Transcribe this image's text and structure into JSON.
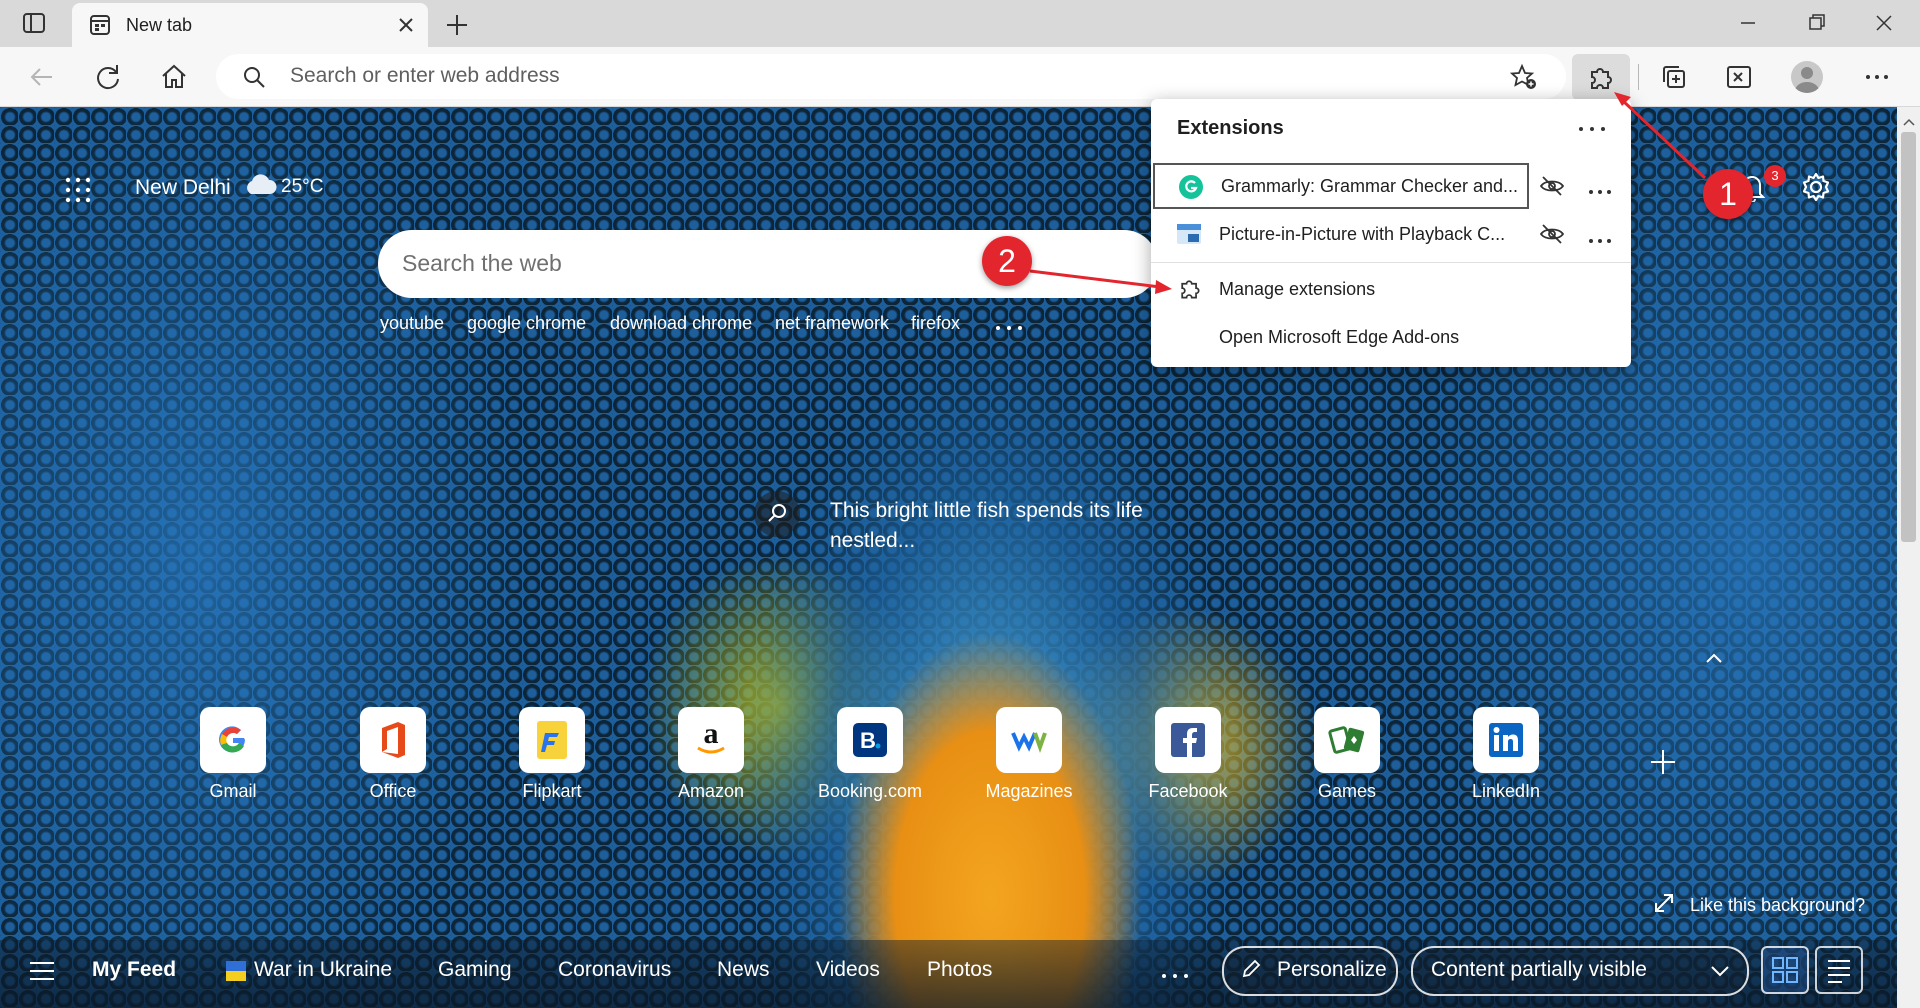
{
  "tab": {
    "title": "New tab"
  },
  "address": {
    "placeholder": "Search or enter web address"
  },
  "weather": {
    "city": "New Delhi",
    "temp": "25°C"
  },
  "search": {
    "placeholder": "Search the web"
  },
  "quick_links": [
    "youtube",
    "google chrome",
    "download chrome",
    "net framework",
    "firefox"
  ],
  "background_caption": "This bright little fish spends its life nestled...",
  "notification_count": "3",
  "tiles": [
    {
      "label": "Gmail",
      "icon": "google-icon"
    },
    {
      "label": "Office",
      "icon": "office-icon"
    },
    {
      "label": "Flipkart",
      "icon": "flipkart-icon"
    },
    {
      "label": "Amazon",
      "icon": "amazon-icon"
    },
    {
      "label": "Booking.com",
      "icon": "booking-icon"
    },
    {
      "label": "Magazines",
      "icon": "magazines-icon"
    },
    {
      "label": "Facebook",
      "icon": "facebook-icon"
    },
    {
      "label": "Games",
      "icon": "games-icon"
    },
    {
      "label": "LinkedIn",
      "icon": "linkedin-icon"
    }
  ],
  "like_background": "Like this background?",
  "feed": {
    "my_feed": "My Feed",
    "items": [
      "War in Ukraine",
      "Gaming",
      "Coronavirus",
      "News",
      "Videos",
      "Photos"
    ],
    "personalize": "Personalize",
    "content_visibility": "Content partially visible"
  },
  "extensions_popup": {
    "title": "Extensions",
    "extensions": [
      {
        "name": "Grammarly: Grammar Checker and..."
      },
      {
        "name": "Picture-in-Picture with Playback C..."
      }
    ],
    "manage": "Manage extensions",
    "addons": "Open Microsoft Edge Add-ons"
  },
  "annotations": {
    "step1": "1",
    "step2": "2"
  },
  "colors": {
    "accent_red": "#e3262d",
    "grammarly_green": "#15c39a",
    "toolbar": "#f7f7f7"
  }
}
